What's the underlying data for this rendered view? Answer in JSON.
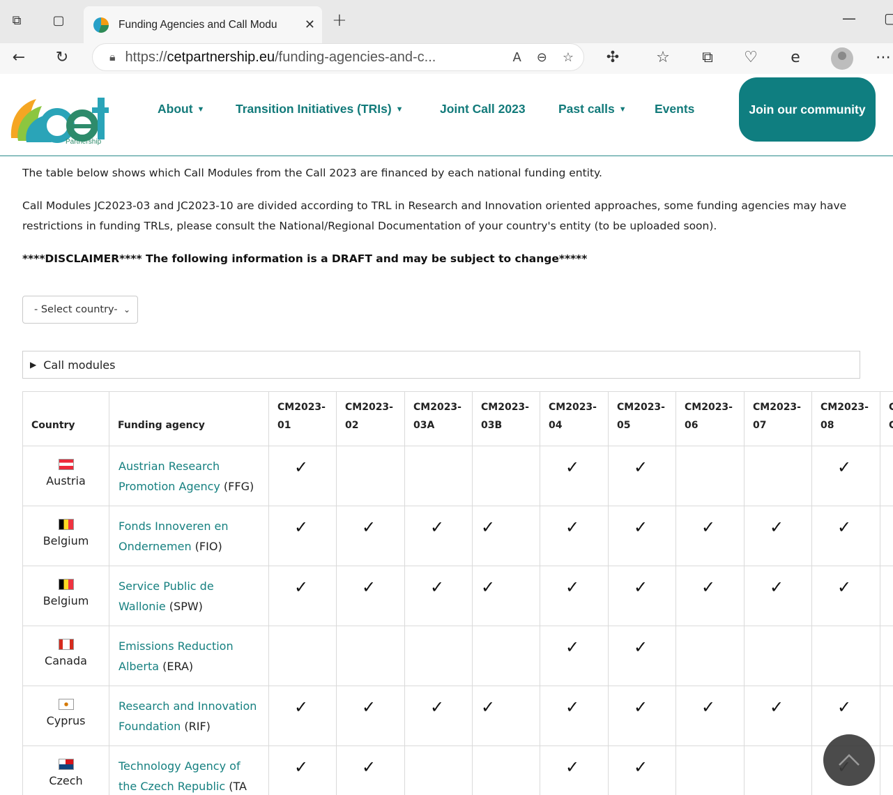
{
  "browser": {
    "tab_title": "Funding Agencies and Call Modu",
    "url_prefix": "https://",
    "url_host": "cetpartnership.eu",
    "url_path": "/funding-agencies-and-c..."
  },
  "site": {
    "logo_text": "cet",
    "logo_sub": "Partnership",
    "nav": [
      {
        "label": "About",
        "has_dropdown": true
      },
      {
        "label": "Transition Initiatives (TRIs)",
        "has_dropdown": true
      },
      {
        "label": "Joint Call 2023",
        "has_dropdown": false
      },
      {
        "label": "Past calls",
        "has_dropdown": true
      },
      {
        "label": "Events",
        "has_dropdown": false
      }
    ],
    "join_label": "Join our community",
    "brand_color": "#0f7e80"
  },
  "content": {
    "intro": "The table below shows which Call Modules from the Call 2023 are financed by each national funding entity.",
    "trl_note": "Call Modules JC2023-03 and JC2023-10 are divided according to TRL in Research and Innovation oriented approaches, some funding agencies may have restrictions in funding TRLs, please consult the National/Regional Documentation of your country's entity (to be uploaded soon).",
    "disclaimer": "****DISCLAIMER**** The following information is a DRAFT and may be subject to change*****",
    "select_placeholder": "- Select country-",
    "details_label": "Call modules"
  },
  "table": {
    "header_country": "Country",
    "header_agency": "Funding agency",
    "modules": [
      {
        "top": "CM2023-",
        "bottom": "01"
      },
      {
        "top": "CM2023-",
        "bottom": "02"
      },
      {
        "top": "CM2023-",
        "bottom": "03A"
      },
      {
        "top": "CM2023-",
        "bottom": "03B"
      },
      {
        "top": "CM2023-",
        "bottom": "04"
      },
      {
        "top": "CM2023-",
        "bottom": "05"
      },
      {
        "top": "CM2023-",
        "bottom": "06"
      },
      {
        "top": "CM2023-",
        "bottom": "07"
      },
      {
        "top": "CM2023-",
        "bottom": "08"
      },
      {
        "top": "C",
        "bottom": "C"
      }
    ],
    "rows": [
      {
        "country": "Austria",
        "flag": "austria",
        "agency_line1": "Austrian Research",
        "agency_line2": "Promotion Agency",
        "agency_abbr": " (FFG)",
        "checks": [
          1,
          0,
          0,
          0,
          1,
          1,
          0,
          0,
          1,
          0
        ]
      },
      {
        "country": "Belgium",
        "flag": "belgium",
        "agency_line1": "Fonds Innoveren en",
        "agency_line2": "Ondernemen",
        "agency_abbr": " (FIO)",
        "checks": [
          1,
          1,
          1,
          1,
          1,
          1,
          1,
          1,
          1,
          0
        ]
      },
      {
        "country": "Belgium",
        "flag": "belgium",
        "agency_line1": "Service Public de",
        "agency_line2": "Wallonie",
        "agency_abbr": " (SPW)",
        "checks": [
          1,
          1,
          1,
          1,
          1,
          1,
          1,
          1,
          1,
          0
        ]
      },
      {
        "country": "Canada",
        "flag": "canada",
        "agency_line1": "Emissions Reduction",
        "agency_line2": "Alberta",
        "agency_abbr": " (ERA)",
        "checks": [
          0,
          0,
          0,
          0,
          1,
          1,
          0,
          0,
          0,
          0
        ]
      },
      {
        "country": "Cyprus",
        "flag": "cyprus",
        "agency_line1": "Research and Innovation",
        "agency_line2": "Foundation",
        "agency_abbr": " (RIF)",
        "checks": [
          1,
          1,
          1,
          1,
          1,
          1,
          1,
          1,
          1,
          0
        ]
      },
      {
        "country": "Czech",
        "flag": "czech",
        "agency_line1": "Technology Agency of",
        "agency_line2": "the Czech Republic",
        "agency_abbr": " (TA",
        "checks": [
          1,
          1,
          0,
          0,
          1,
          1,
          0,
          0,
          1,
          0
        ]
      }
    ],
    "check_glyph": "✓"
  }
}
